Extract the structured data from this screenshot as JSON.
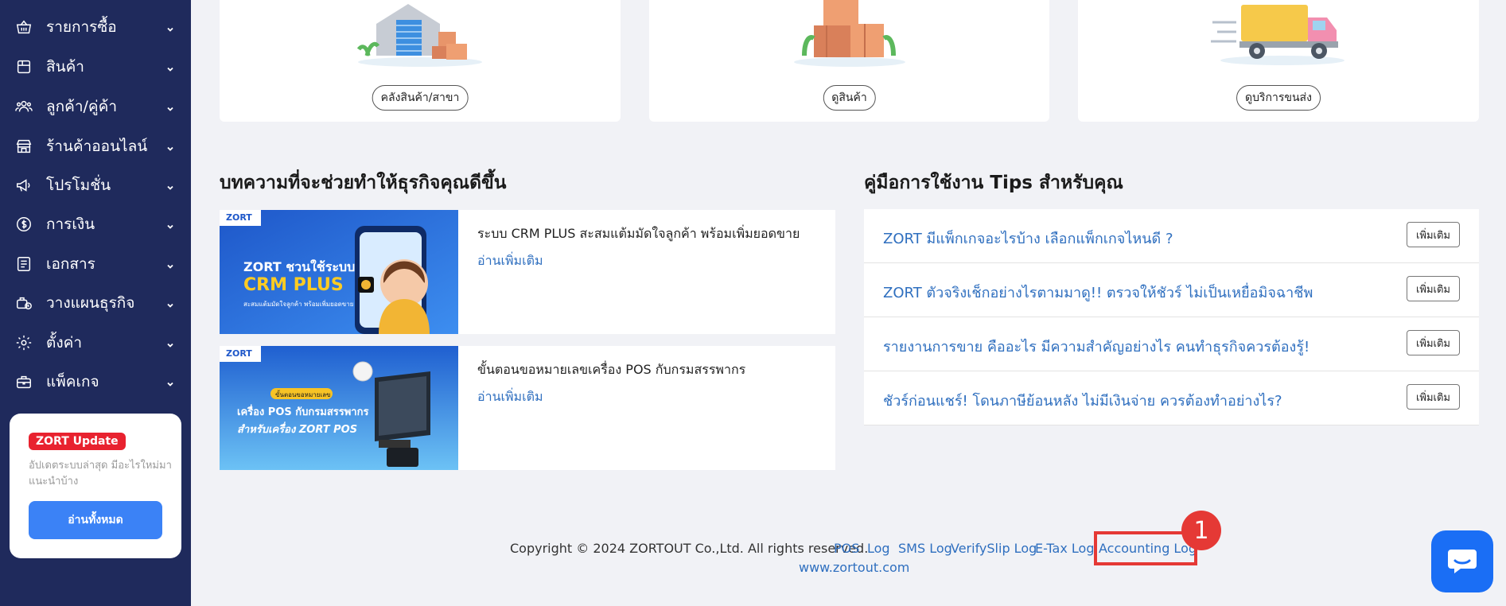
{
  "sidebar": {
    "items": [
      {
        "label": "รายการซื้อ",
        "icon": "basket-icon"
      },
      {
        "label": "สินค้า",
        "icon": "box-icon"
      },
      {
        "label": "ลูกค้า/คู่ค้า",
        "icon": "users-icon"
      },
      {
        "label": "ร้านค้าออนไลน์",
        "icon": "store-icon"
      },
      {
        "label": "โปรโมชั่น",
        "icon": "megaphone-icon"
      },
      {
        "label": "การเงิน",
        "icon": "dollar-icon"
      },
      {
        "label": "เอกสาร",
        "icon": "document-icon"
      },
      {
        "label": "วางแผนธุรกิจ",
        "icon": "planning-icon"
      },
      {
        "label": "ตั้งค่า",
        "icon": "gear-icon"
      },
      {
        "label": "แพ็คเกจ",
        "icon": "package-icon"
      }
    ],
    "update_card": {
      "badge": "ZORT Update",
      "description": "อัปเดตระบบล่าสุด มีอะไรใหม่มาแนะนำบ้าง",
      "button": "อ่านทั้งหมด"
    }
  },
  "top_cards": [
    {
      "label": "คลังสินค้า/สาขา"
    },
    {
      "label": "ดูสินค้า"
    },
    {
      "label": "ดูบริการขนส่ง"
    }
  ],
  "articles_section": {
    "title": "บทความที่จะช่วยทำให้ธุรกิจคุณดีขึ้น",
    "items": [
      {
        "title": "ระบบ CRM PLUS สะสมแต้มมัดใจลูกค้า พร้อมเพิ่มยอดขาย",
        "link": "อ่านเพิ่มเติม",
        "thumb": {
          "brand": "ZORT",
          "line1": "ZORT ชวนใช้ระบบ",
          "line2": "CRM PLUS",
          "line3": "สะสมแต้มมัดใจลูกค้า พร้อมเพิ่มยอดขาย"
        }
      },
      {
        "title": "ขั้นตอนขอหมายเลขเครื่อง POS กับกรมสรรพากร",
        "link": "อ่านเพิ่มเติม",
        "thumb": {
          "brand": "ZORT",
          "line0": "ขั้นตอนขอหมายเลข",
          "line1": "เครื่อง POS กับกรมสรรพากร",
          "line2": "สำหรับเครื่อง ZORT POS"
        }
      }
    ]
  },
  "tips_section": {
    "title": "คู่มือการใช้งาน Tips สำหรับคุณ",
    "items": [
      {
        "text": "ZORT มีแพ็กเกจอะไรบ้าง เลือกแพ็กเกจไหนดี ?",
        "button": "เพิ่มเติม"
      },
      {
        "text": "ZORT ตัวจริงเช็กอย่างไรตามมาดู!! ตรวจให้ชัวร์ ไม่เป็นเหยื่อมิจฉาชีพ",
        "button": "เพิ่มเติม"
      },
      {
        "text": "รายงานการขาย คืออะไร มีความสำคัญอย่างไร คนทำธุรกิจควรต้องรู้!",
        "button": "เพิ่มเติม"
      },
      {
        "text": "ชัวร์ก่อนแชร์! โดนภาษีย้อนหลัง ไม่มีเงินจ่าย ควรต้องทำอย่างไร?",
        "button": "เพิ่มเติม"
      }
    ]
  },
  "footer": {
    "copyright": "Copyright © 2024 ZORTOUT Co.,Ltd. All rights reserved.",
    "links": [
      "POS",
      "Log",
      "SMS Log",
      "VerifySlip Log",
      "E-Tax Log",
      "Accounting Log"
    ],
    "website": "www.zortout.com"
  },
  "annotation": {
    "step": "1"
  },
  "colors": {
    "sidebar_bg": "#1f2a5c",
    "accent_blue": "#3b82f6",
    "link_blue": "#2f6fbf",
    "badge_red": "#e8222f",
    "highlight_red": "#e53935"
  }
}
